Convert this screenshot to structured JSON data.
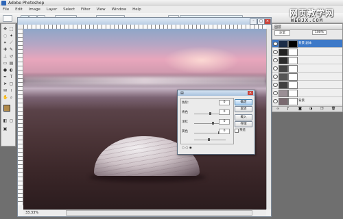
{
  "app": {
    "title": "Adobe Photoshop",
    "menu": [
      "File",
      "Edit",
      "Image",
      "Layer",
      "Select",
      "Filter",
      "View",
      "Window",
      "Help"
    ]
  },
  "watermark": {
    "main": "网页教学网",
    "url": "WEBJX.COM"
  },
  "document": {
    "zoom": "33.33%"
  },
  "dialog": {
    "ok_label": "确定",
    "cancel_label": "取消",
    "load_label": "载入",
    "save_label": "存储",
    "preview_label": "预览",
    "rows": [
      {
        "label": "色阶:",
        "value": "0"
      },
      {
        "label": "青色",
        "value": "0"
      },
      {
        "label": "洋红",
        "value": "0"
      },
      {
        "label": "黄色",
        "value": "0"
      }
    ],
    "slider_positions": [
      0.5,
      0.6,
      0.8,
      0.45
    ]
  },
  "layers": {
    "tab_label": "图层",
    "blend": "正常",
    "opacity": "100%",
    "items": [
      {
        "name": "背景 副本",
        "selected": true,
        "thumb": "#1b2c47"
      },
      {
        "name": "",
        "selected": false,
        "thumb": "#222222"
      },
      {
        "name": "",
        "selected": false,
        "thumb": "#2b2b2b"
      },
      {
        "name": "",
        "selected": false,
        "thumb": "#444444"
      },
      {
        "name": "",
        "selected": false,
        "thumb": "#555555"
      },
      {
        "name": "",
        "selected": false,
        "thumb": "#3f3f3f"
      },
      {
        "name": "",
        "selected": false,
        "thumb": "#9a8f95"
      },
      {
        "name": "背景",
        "selected": false,
        "thumb": "#7a6a70"
      }
    ]
  },
  "colors": {
    "accent": "#3d79c8",
    "foreground_swatch": "#b18a4a",
    "background_swatch": "#ffffff"
  }
}
